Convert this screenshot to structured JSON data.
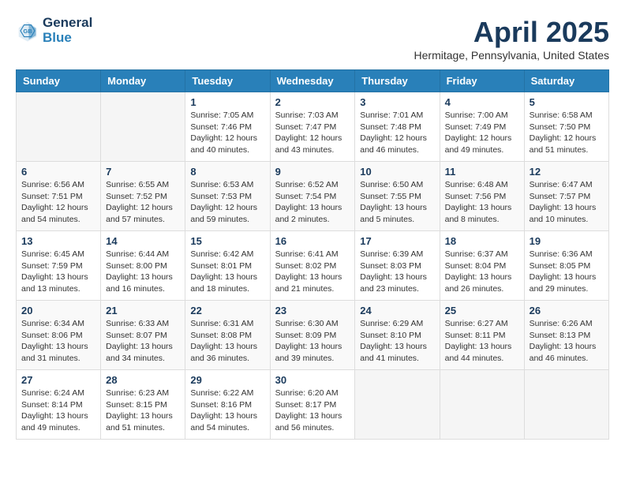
{
  "header": {
    "logo_line1": "General",
    "logo_line2": "Blue",
    "month": "April 2025",
    "location": "Hermitage, Pennsylvania, United States"
  },
  "weekdays": [
    "Sunday",
    "Monday",
    "Tuesday",
    "Wednesday",
    "Thursday",
    "Friday",
    "Saturday"
  ],
  "weeks": [
    [
      {
        "day": "",
        "info": ""
      },
      {
        "day": "",
        "info": ""
      },
      {
        "day": "1",
        "info": "Sunrise: 7:05 AM\nSunset: 7:46 PM\nDaylight: 12 hours\nand 40 minutes."
      },
      {
        "day": "2",
        "info": "Sunrise: 7:03 AM\nSunset: 7:47 PM\nDaylight: 12 hours\nand 43 minutes."
      },
      {
        "day": "3",
        "info": "Sunrise: 7:01 AM\nSunset: 7:48 PM\nDaylight: 12 hours\nand 46 minutes."
      },
      {
        "day": "4",
        "info": "Sunrise: 7:00 AM\nSunset: 7:49 PM\nDaylight: 12 hours\nand 49 minutes."
      },
      {
        "day": "5",
        "info": "Sunrise: 6:58 AM\nSunset: 7:50 PM\nDaylight: 12 hours\nand 51 minutes."
      }
    ],
    [
      {
        "day": "6",
        "info": "Sunrise: 6:56 AM\nSunset: 7:51 PM\nDaylight: 12 hours\nand 54 minutes."
      },
      {
        "day": "7",
        "info": "Sunrise: 6:55 AM\nSunset: 7:52 PM\nDaylight: 12 hours\nand 57 minutes."
      },
      {
        "day": "8",
        "info": "Sunrise: 6:53 AM\nSunset: 7:53 PM\nDaylight: 12 hours\nand 59 minutes."
      },
      {
        "day": "9",
        "info": "Sunrise: 6:52 AM\nSunset: 7:54 PM\nDaylight: 13 hours\nand 2 minutes."
      },
      {
        "day": "10",
        "info": "Sunrise: 6:50 AM\nSunset: 7:55 PM\nDaylight: 13 hours\nand 5 minutes."
      },
      {
        "day": "11",
        "info": "Sunrise: 6:48 AM\nSunset: 7:56 PM\nDaylight: 13 hours\nand 8 minutes."
      },
      {
        "day": "12",
        "info": "Sunrise: 6:47 AM\nSunset: 7:57 PM\nDaylight: 13 hours\nand 10 minutes."
      }
    ],
    [
      {
        "day": "13",
        "info": "Sunrise: 6:45 AM\nSunset: 7:59 PM\nDaylight: 13 hours\nand 13 minutes."
      },
      {
        "day": "14",
        "info": "Sunrise: 6:44 AM\nSunset: 8:00 PM\nDaylight: 13 hours\nand 16 minutes."
      },
      {
        "day": "15",
        "info": "Sunrise: 6:42 AM\nSunset: 8:01 PM\nDaylight: 13 hours\nand 18 minutes."
      },
      {
        "day": "16",
        "info": "Sunrise: 6:41 AM\nSunset: 8:02 PM\nDaylight: 13 hours\nand 21 minutes."
      },
      {
        "day": "17",
        "info": "Sunrise: 6:39 AM\nSunset: 8:03 PM\nDaylight: 13 hours\nand 23 minutes."
      },
      {
        "day": "18",
        "info": "Sunrise: 6:37 AM\nSunset: 8:04 PM\nDaylight: 13 hours\nand 26 minutes."
      },
      {
        "day": "19",
        "info": "Sunrise: 6:36 AM\nSunset: 8:05 PM\nDaylight: 13 hours\nand 29 minutes."
      }
    ],
    [
      {
        "day": "20",
        "info": "Sunrise: 6:34 AM\nSunset: 8:06 PM\nDaylight: 13 hours\nand 31 minutes."
      },
      {
        "day": "21",
        "info": "Sunrise: 6:33 AM\nSunset: 8:07 PM\nDaylight: 13 hours\nand 34 minutes."
      },
      {
        "day": "22",
        "info": "Sunrise: 6:31 AM\nSunset: 8:08 PM\nDaylight: 13 hours\nand 36 minutes."
      },
      {
        "day": "23",
        "info": "Sunrise: 6:30 AM\nSunset: 8:09 PM\nDaylight: 13 hours\nand 39 minutes."
      },
      {
        "day": "24",
        "info": "Sunrise: 6:29 AM\nSunset: 8:10 PM\nDaylight: 13 hours\nand 41 minutes."
      },
      {
        "day": "25",
        "info": "Sunrise: 6:27 AM\nSunset: 8:11 PM\nDaylight: 13 hours\nand 44 minutes."
      },
      {
        "day": "26",
        "info": "Sunrise: 6:26 AM\nSunset: 8:13 PM\nDaylight: 13 hours\nand 46 minutes."
      }
    ],
    [
      {
        "day": "27",
        "info": "Sunrise: 6:24 AM\nSunset: 8:14 PM\nDaylight: 13 hours\nand 49 minutes."
      },
      {
        "day": "28",
        "info": "Sunrise: 6:23 AM\nSunset: 8:15 PM\nDaylight: 13 hours\nand 51 minutes."
      },
      {
        "day": "29",
        "info": "Sunrise: 6:22 AM\nSunset: 8:16 PM\nDaylight: 13 hours\nand 54 minutes."
      },
      {
        "day": "30",
        "info": "Sunrise: 6:20 AM\nSunset: 8:17 PM\nDaylight: 13 hours\nand 56 minutes."
      },
      {
        "day": "",
        "info": ""
      },
      {
        "day": "",
        "info": ""
      },
      {
        "day": "",
        "info": ""
      }
    ]
  ]
}
